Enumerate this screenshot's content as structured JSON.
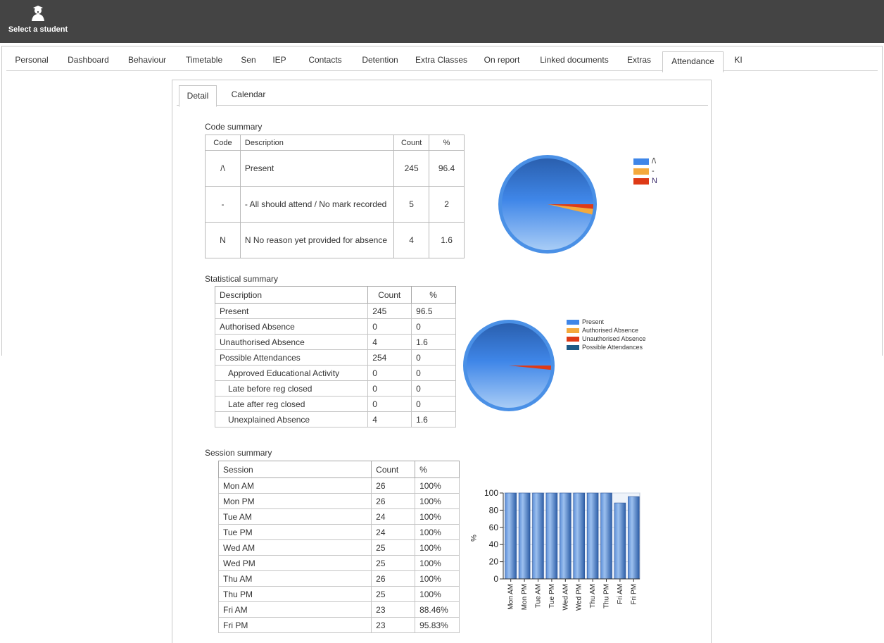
{
  "header": {
    "select_student_label": "Select a student",
    "icon": "student-icon"
  },
  "main_tabs": [
    {
      "label": "Personal",
      "active": false
    },
    {
      "label": "Dashboard",
      "active": false
    },
    {
      "label": "Behaviour",
      "active": false
    },
    {
      "label": "Timetable",
      "active": false
    },
    {
      "label": "Sen",
      "active": false
    },
    {
      "label": "IEP",
      "active": false
    },
    {
      "label": "Contacts",
      "active": false
    },
    {
      "label": "Detention",
      "active": false
    },
    {
      "label": "Extra Classes",
      "active": false
    },
    {
      "label": "On report",
      "active": false
    },
    {
      "label": "Linked documents",
      "active": false
    },
    {
      "label": "Extras",
      "active": false
    },
    {
      "label": "Attendance",
      "active": true
    },
    {
      "label": "KI",
      "active": false
    }
  ],
  "sub_tabs": [
    {
      "label": "Detail",
      "active": true
    },
    {
      "label": "Calendar",
      "active": false
    }
  ],
  "code_summary": {
    "title": "Code summary",
    "headers": [
      "Code",
      "Description",
      "Count",
      "%"
    ],
    "rows": [
      {
        "code": "/\\",
        "description": "Present",
        "count": "245",
        "pct": "96.4"
      },
      {
        "code": "-",
        "description": "- All should attend / No mark recorded",
        "count": "5",
        "pct": "2"
      },
      {
        "code": "N",
        "description": "N No reason yet provided for absence",
        "count": "4",
        "pct": "1.6"
      }
    ],
    "legend": [
      "/\\",
      "-",
      "N"
    ]
  },
  "statistical_summary": {
    "title": "Statistical summary",
    "headers": [
      "Description",
      "Count",
      "%"
    ],
    "rows": [
      {
        "description": "Present",
        "count": "245",
        "pct": "96.5",
        "indent": false
      },
      {
        "description": "Authorised Absence",
        "count": "0",
        "pct": "0",
        "indent": false
      },
      {
        "description": "Unauthorised Absence",
        "count": "4",
        "pct": "1.6",
        "indent": false
      },
      {
        "description": "Possible Attendances",
        "count": "254",
        "pct": "0",
        "indent": false
      },
      {
        "description": "Approved Educational Activity",
        "count": "0",
        "pct": "0",
        "indent": true
      },
      {
        "description": "Late before reg closed",
        "count": "0",
        "pct": "0",
        "indent": true
      },
      {
        "description": "Late after reg closed",
        "count": "0",
        "pct": "0",
        "indent": true
      },
      {
        "description": "Unexplained Absence",
        "count": "4",
        "pct": "1.6",
        "indent": true
      }
    ],
    "legend": [
      "Present",
      "Authorised Absence",
      "Unauthorised Absence",
      "Possible Attendances"
    ]
  },
  "session_summary": {
    "title": "Session summary",
    "headers": [
      "Session",
      "Count",
      "%"
    ],
    "rows": [
      {
        "session": "Mon AM",
        "count": "26",
        "pct": "100%"
      },
      {
        "session": "Mon PM",
        "count": "26",
        "pct": "100%"
      },
      {
        "session": "Tue AM",
        "count": "24",
        "pct": "100%"
      },
      {
        "session": "Tue PM",
        "count": "24",
        "pct": "100%"
      },
      {
        "session": "Wed AM",
        "count": "25",
        "pct": "100%"
      },
      {
        "session": "Wed PM",
        "count": "25",
        "pct": "100%"
      },
      {
        "session": "Thu AM",
        "count": "26",
        "pct": "100%"
      },
      {
        "session": "Thu PM",
        "count": "25",
        "pct": "100%"
      },
      {
        "session": "Fri AM",
        "count": "23",
        "pct": "88.46%"
      },
      {
        "session": "Fri PM",
        "count": "23",
        "pct": "95.83%"
      }
    ]
  },
  "colors": {
    "present": "#3f86e8",
    "dash": "#f4a93c",
    "n": "#de3a16",
    "possible": "#1d5a86",
    "topbar": "#444444"
  },
  "chart_data": [
    {
      "type": "pie",
      "categories": [
        "/\\",
        "-",
        "N"
      ],
      "values": [
        96.4,
        2,
        1.6
      ],
      "legend": "right"
    },
    {
      "type": "pie",
      "categories": [
        "Present",
        "Authorised Absence",
        "Unauthorised Absence",
        "Possible Attendances"
      ],
      "values": [
        96.5,
        0,
        1.6,
        0
      ],
      "legend": "right"
    },
    {
      "type": "bar",
      "categories": [
        "Mon AM",
        "Mon PM",
        "Tue AM",
        "Tue PM",
        "Wed AM",
        "Wed PM",
        "Thu AM",
        "Thu PM",
        "Fri AM",
        "Fri PM"
      ],
      "values": [
        100,
        100,
        100,
        100,
        100,
        100,
        100,
        100,
        88.46,
        95.83
      ],
      "ylabel": "%",
      "ylim": [
        0,
        100
      ],
      "yticks": [
        0,
        20,
        40,
        60,
        80,
        100
      ],
      "grid": true
    }
  ]
}
